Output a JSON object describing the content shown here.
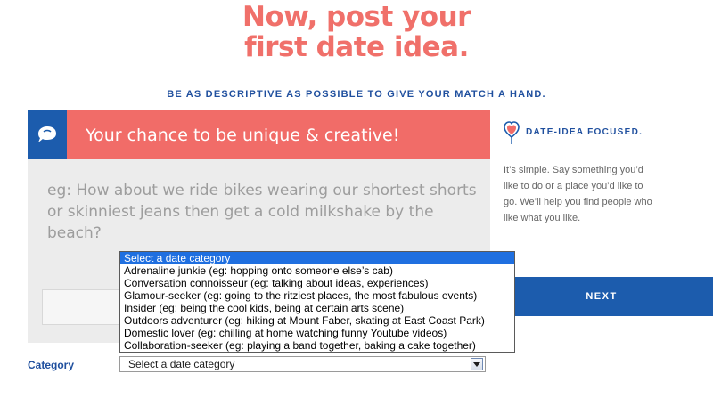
{
  "page": {
    "headline_line1": "Now, post your",
    "headline_line2": "first date idea.",
    "subheading": "BE AS DESCRIPTIVE AS POSSIBLE TO GIVE YOUR MATCH A HAND."
  },
  "card": {
    "icon": "speech-bubble-icon",
    "title": "Your chance to be unique & creative!",
    "idea_placeholder": "eg: How about we ride bikes wearing our shortest shorts or skinniest jeans then get a cold milkshake by the beach?"
  },
  "sidebar": {
    "icon": "heart-balloon-icon",
    "title": "DATE-IDEA FOCUSED.",
    "text": "It’s simple. Say something you’d like to do or a place you’d like to go. We’ll help you find people who like what you like."
  },
  "next_button": {
    "label": "NEXT"
  },
  "category": {
    "label": "Category",
    "selected": "Select a date category",
    "options": [
      "Select a date category",
      "Adrenaline junkie (eg: hopping onto someone else’s cab)",
      "Conversation connoisseur (eg: talking about ideas, experiences)",
      "Glamour-seeker (eg: going to the ritziest places, the most fabulous events)",
      "Insider (eg: being the cool kids, being at certain arts scene)",
      "Outdoors adventurer (eg: hiking at Mount Faber, skating at East Coast Park)",
      "Domestic lover (eg: chilling at home watching funny Youtube videos)",
      "Collaboration-seeker (eg: playing a band together, baking a cake together)"
    ],
    "highlighted_index": 0
  },
  "colors": {
    "coral": "#f16c68",
    "blue": "#1c5cad",
    "card_bg": "#ececec",
    "highlight": "#1f6fe0"
  }
}
